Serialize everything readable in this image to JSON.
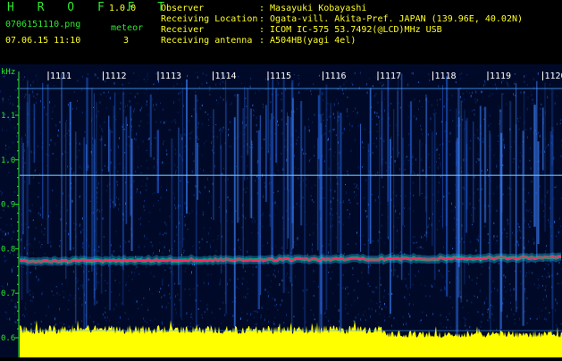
{
  "app": {
    "name": "H R O F F T",
    "version": "1.0.0"
  },
  "file": {
    "name": "0706151110.png",
    "datetime": "07.06.15 11:10"
  },
  "meteor": {
    "label": "meteor",
    "count": "3"
  },
  "info": {
    "observer_label": "Observer",
    "observer_value": ": Masayuki Kobayashi",
    "location_label": "Receiving Location",
    "location_value": ": Ogata-vill. Akita-Pref. JAPAN (139.96E, 40.02N)",
    "receiver_label": "Receiver",
    "receiver_value": ": ICOM IC-575 53.7492(@LCD)MHz USB",
    "antenna_label": "Receiving antenna",
    "antenna_value": ": A504HB(yagi 4el)"
  },
  "waterfall": {
    "unit": "kHz",
    "y_ticks": [
      "1.1",
      "1.0",
      "0.9",
      "0.8",
      "0.7",
      "0.6"
    ],
    "time_ticks": [
      "1111",
      "1112",
      "1113",
      "1114",
      "1115",
      "1116",
      "1117",
      "1118",
      "1119",
      "1120"
    ],
    "colors": {
      "background": "#000a28",
      "signal": "#ff2a60",
      "amplitude": "#ffff00",
      "axis": "#2ee82e"
    }
  }
}
